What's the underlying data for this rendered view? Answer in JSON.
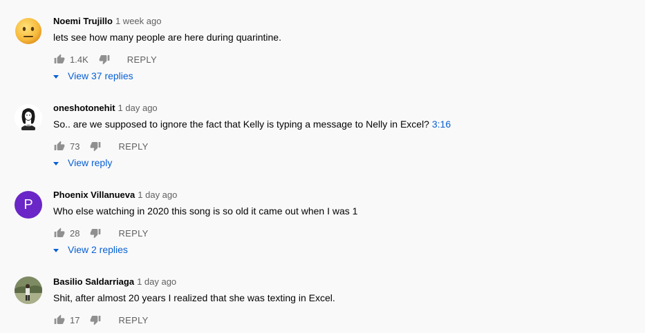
{
  "comments": [
    {
      "author": "Noemi Trujillo",
      "time": "1 week ago",
      "text": "lets see how many people are here during quarintine.",
      "likes": "1.4K",
      "reply_label": "REPLY",
      "view_replies": "View 37 replies",
      "avatar_icon": "neutral-face-emoji"
    },
    {
      "author": "oneshotonehit",
      "time": "1 day ago",
      "text": "So.. are we supposed to ignore the fact that Kelly is typing a message to Nelly in Excel?",
      "timestamp": "3:16",
      "likes": "73",
      "reply_label": "REPLY",
      "view_replies": "View reply",
      "avatar_icon": "sketch-portrait"
    },
    {
      "author": "Phoenix Villanueva",
      "time": "1 day ago",
      "text": "Who else watching in 2020 this song is so old it came out when I was 1",
      "likes": "28",
      "reply_label": "REPLY",
      "view_replies": "View 2 replies",
      "avatar_letter": "P",
      "avatar_color": "#6a26c6"
    },
    {
      "author": "Basilio Saldarriaga",
      "time": "1 day ago",
      "text": "Shit, after almost 20 years I realized that she was texting in Excel.",
      "likes": "17",
      "reply_label": "REPLY",
      "avatar_icon": "person-photo"
    }
  ],
  "colors": {
    "link": "#065fd4",
    "secondary": "#606060",
    "background": "#f9f9f9"
  }
}
